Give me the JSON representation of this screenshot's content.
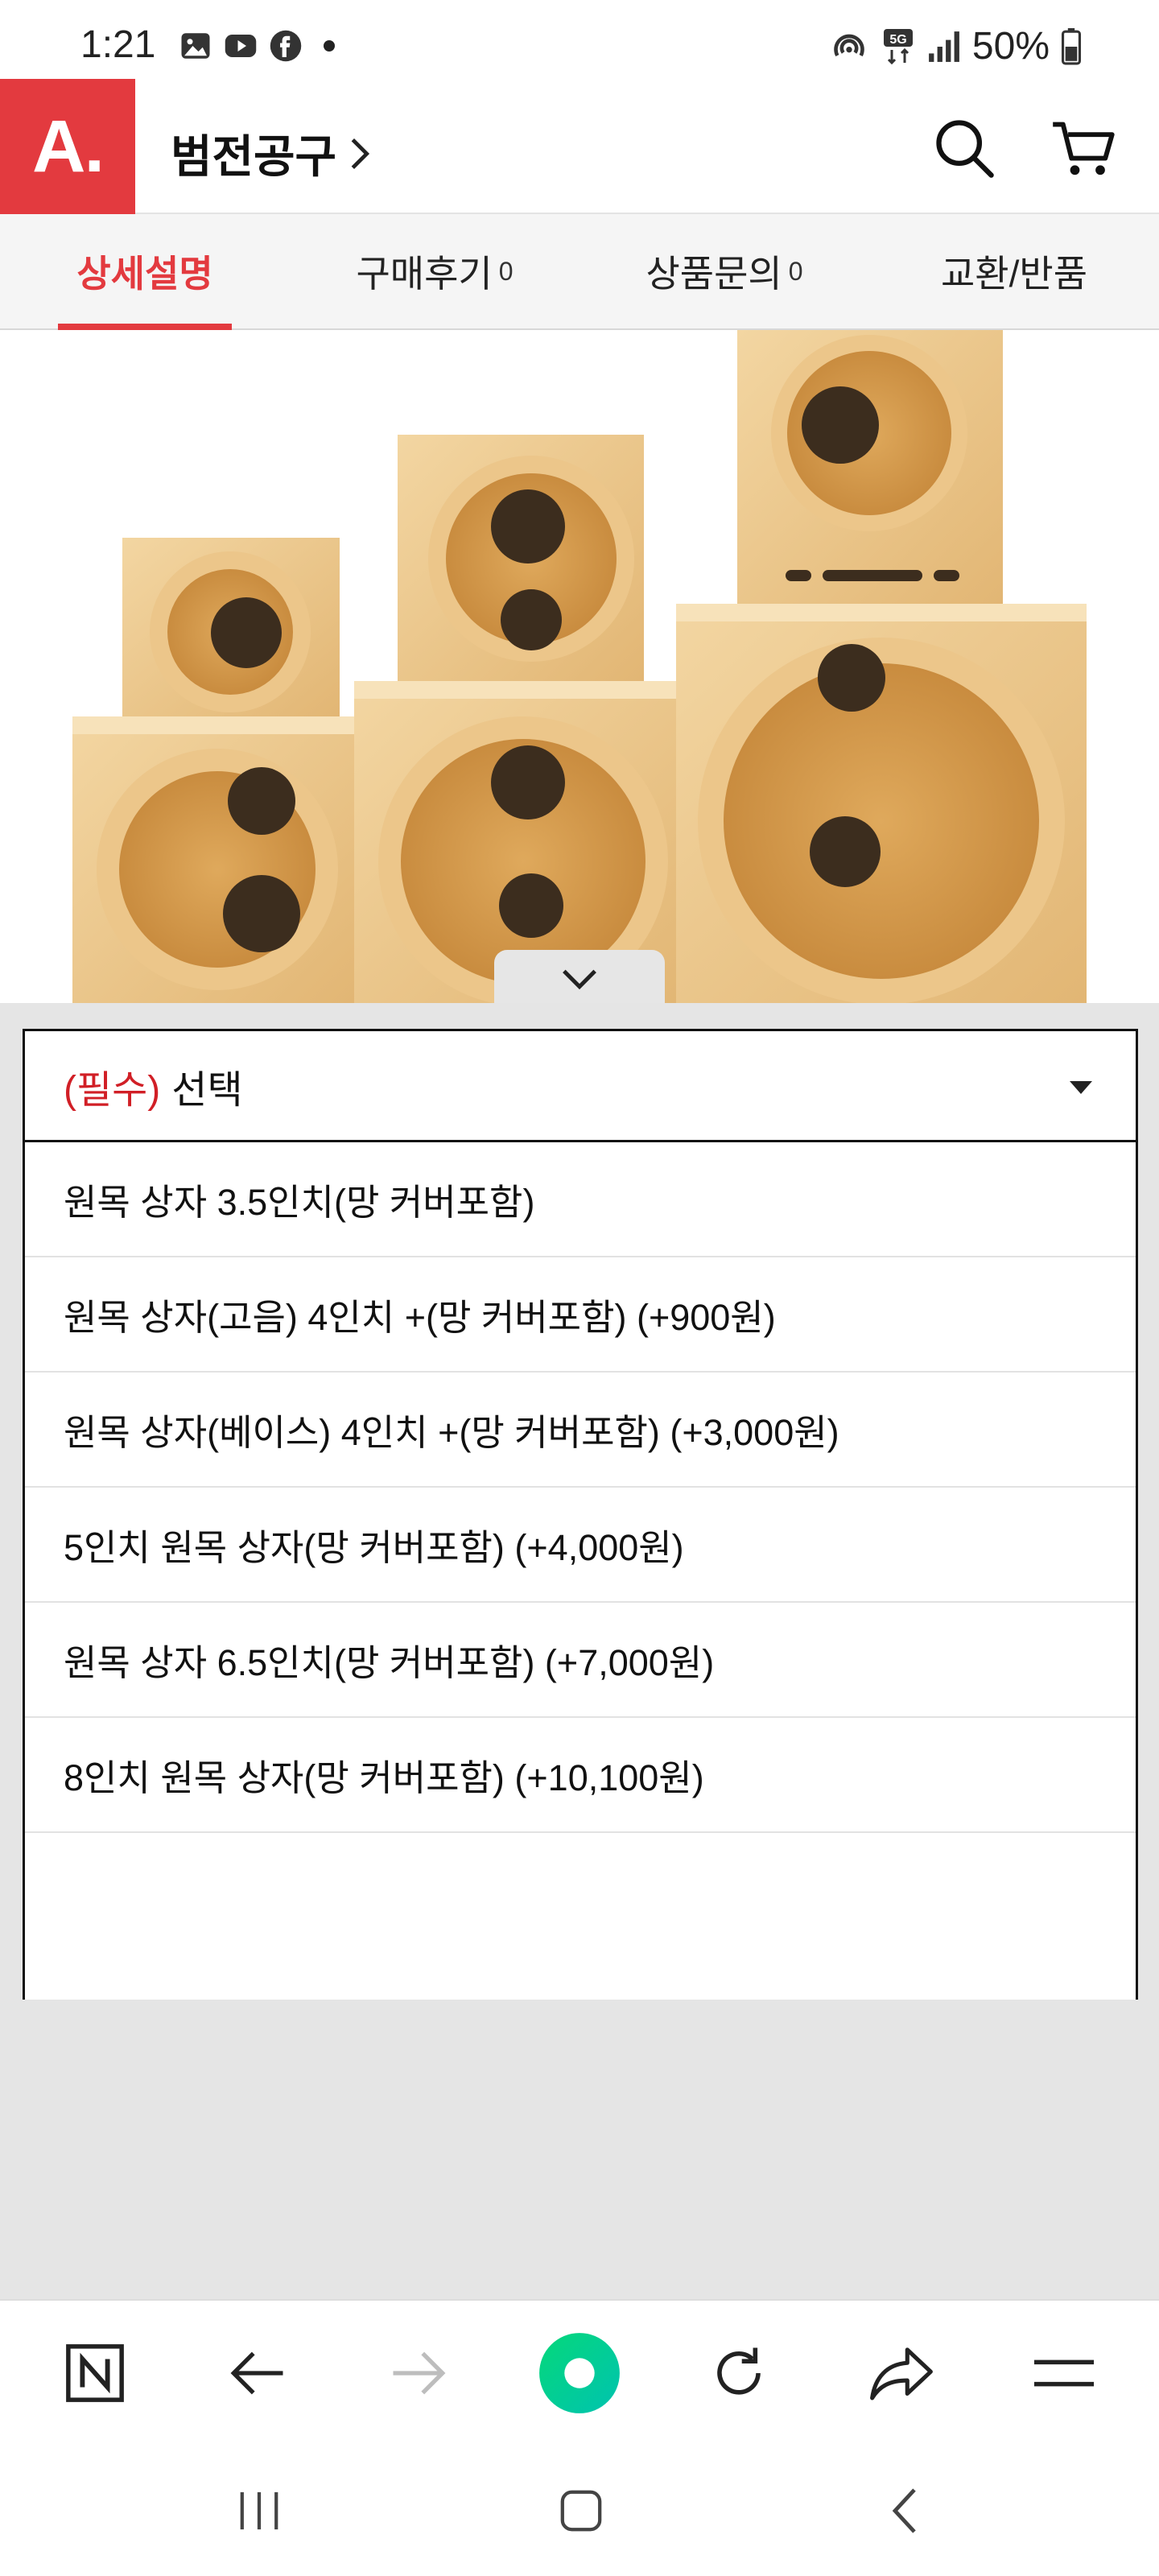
{
  "status_bar": {
    "time": "1:21",
    "battery": "50%",
    "network": "5G"
  },
  "header": {
    "logo_text": "A.",
    "store_name": "범전공구",
    "brand_color": "#e33a3f"
  },
  "tabs": [
    {
      "label": "상세설명",
      "count": "",
      "active": true
    },
    {
      "label": "구매후기",
      "count": "0",
      "active": false
    },
    {
      "label": "상품문의",
      "count": "0",
      "active": false
    },
    {
      "label": "교환/반품",
      "count": "",
      "active": false
    }
  ],
  "option_select": {
    "required_label": "(필수)",
    "placeholder": "선택",
    "options": [
      "원목 상자 3.5인치(망 커버포함)",
      "원목 상자(고음) 4인치 +(망 커버포함) (+900원)",
      "원목 상자(베이스) 4인치 +(망 커버포함) (+3,000원)",
      "5인치 원목 상자(망 커버포함) (+4,000원)",
      "원목 상자 6.5인치(망 커버포함) (+7,000원)",
      "8인치 원목 상자(망 커버포함) (+10,100원)"
    ]
  },
  "icons": {
    "search": "search-icon",
    "cart": "cart-icon",
    "naver": "naver-n-icon",
    "back": "back-arrow-icon",
    "forward": "forward-arrow-icon",
    "home": "home-circle-icon",
    "refresh": "refresh-icon",
    "share": "share-icon",
    "menu": "menu-icon"
  }
}
